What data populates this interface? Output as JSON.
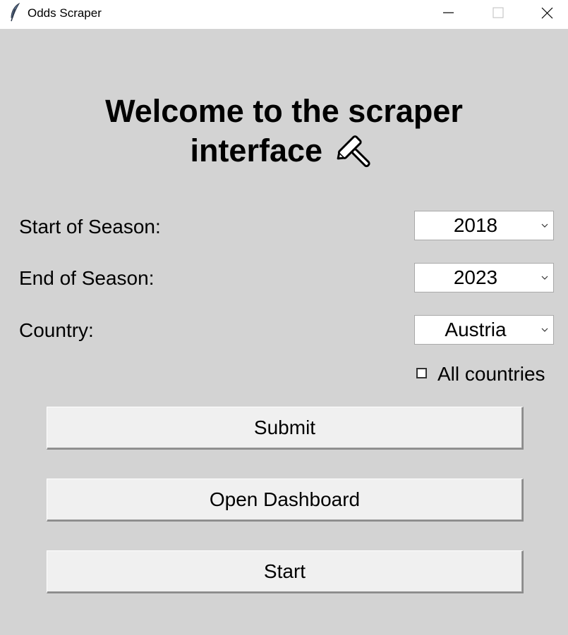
{
  "window": {
    "title": "Odds Scraper",
    "app_icon": "feather-icon",
    "controls": [
      "minimize-icon",
      "maximize-icon",
      "close-icon"
    ]
  },
  "heading": {
    "line1": "Welcome to the scraper",
    "line2": "interface",
    "icon": "hammer-icon"
  },
  "form": {
    "start_season": {
      "label": "Start of Season:",
      "value": "2018"
    },
    "end_season": {
      "label": "End of Season:",
      "value": "2023"
    },
    "country": {
      "label": "Country:",
      "value": "Austria"
    },
    "all_countries": {
      "label": "All countries",
      "checked": false
    }
  },
  "buttons": {
    "submit": "Submit",
    "open_dashboard": "Open Dashboard",
    "start": "Start"
  },
  "colors": {
    "background": "#d3d3d3",
    "titlebar": "#ffffff",
    "button_face": "#f0f0f0"
  }
}
